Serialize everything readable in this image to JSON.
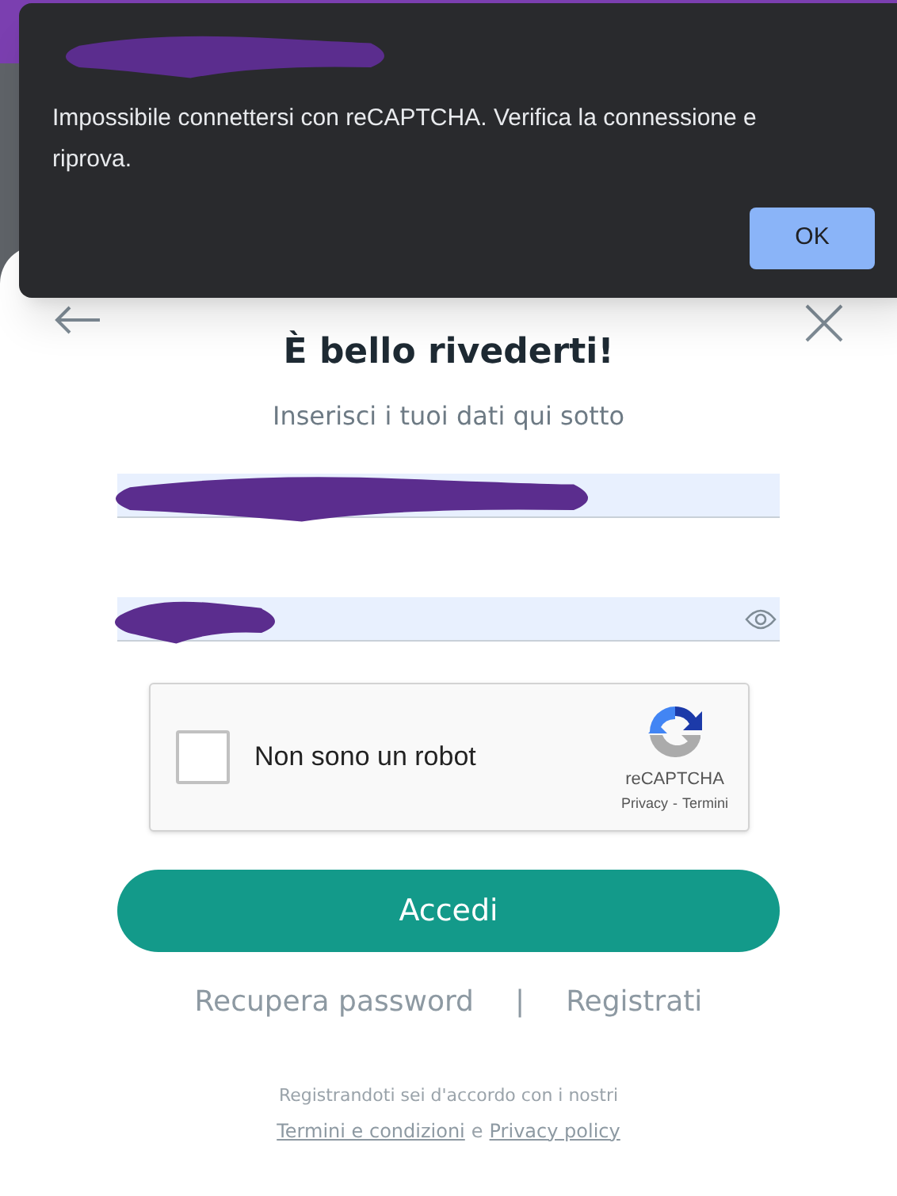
{
  "alert": {
    "message": "Impossibile connettersi con reCAPTCHA. Verifica la connessione e riprova.",
    "buttons": [
      "OK"
    ]
  },
  "login": {
    "title": "È bello rivederti!",
    "subtitle": "Inserisci i tuoi dati qui sotto",
    "fields": [
      {
        "kind": "email"
      },
      {
        "kind": "password"
      }
    ],
    "captcha": {
      "label": "Non sono un robot",
      "checked": false,
      "brand": "reCAPTCHA",
      "privacy": "Privacy",
      "separator": "-",
      "terms": "Termini"
    },
    "submit": "Accedi",
    "links": [
      "Recupera password",
      "Registrati"
    ],
    "link_separator": "|",
    "legal": {
      "text": "Registrandoti sei d'accordo con i nostri",
      "terms_link": "Termini e condizioni",
      "conjunction": "e",
      "privacy_link": "Privacy policy"
    }
  }
}
